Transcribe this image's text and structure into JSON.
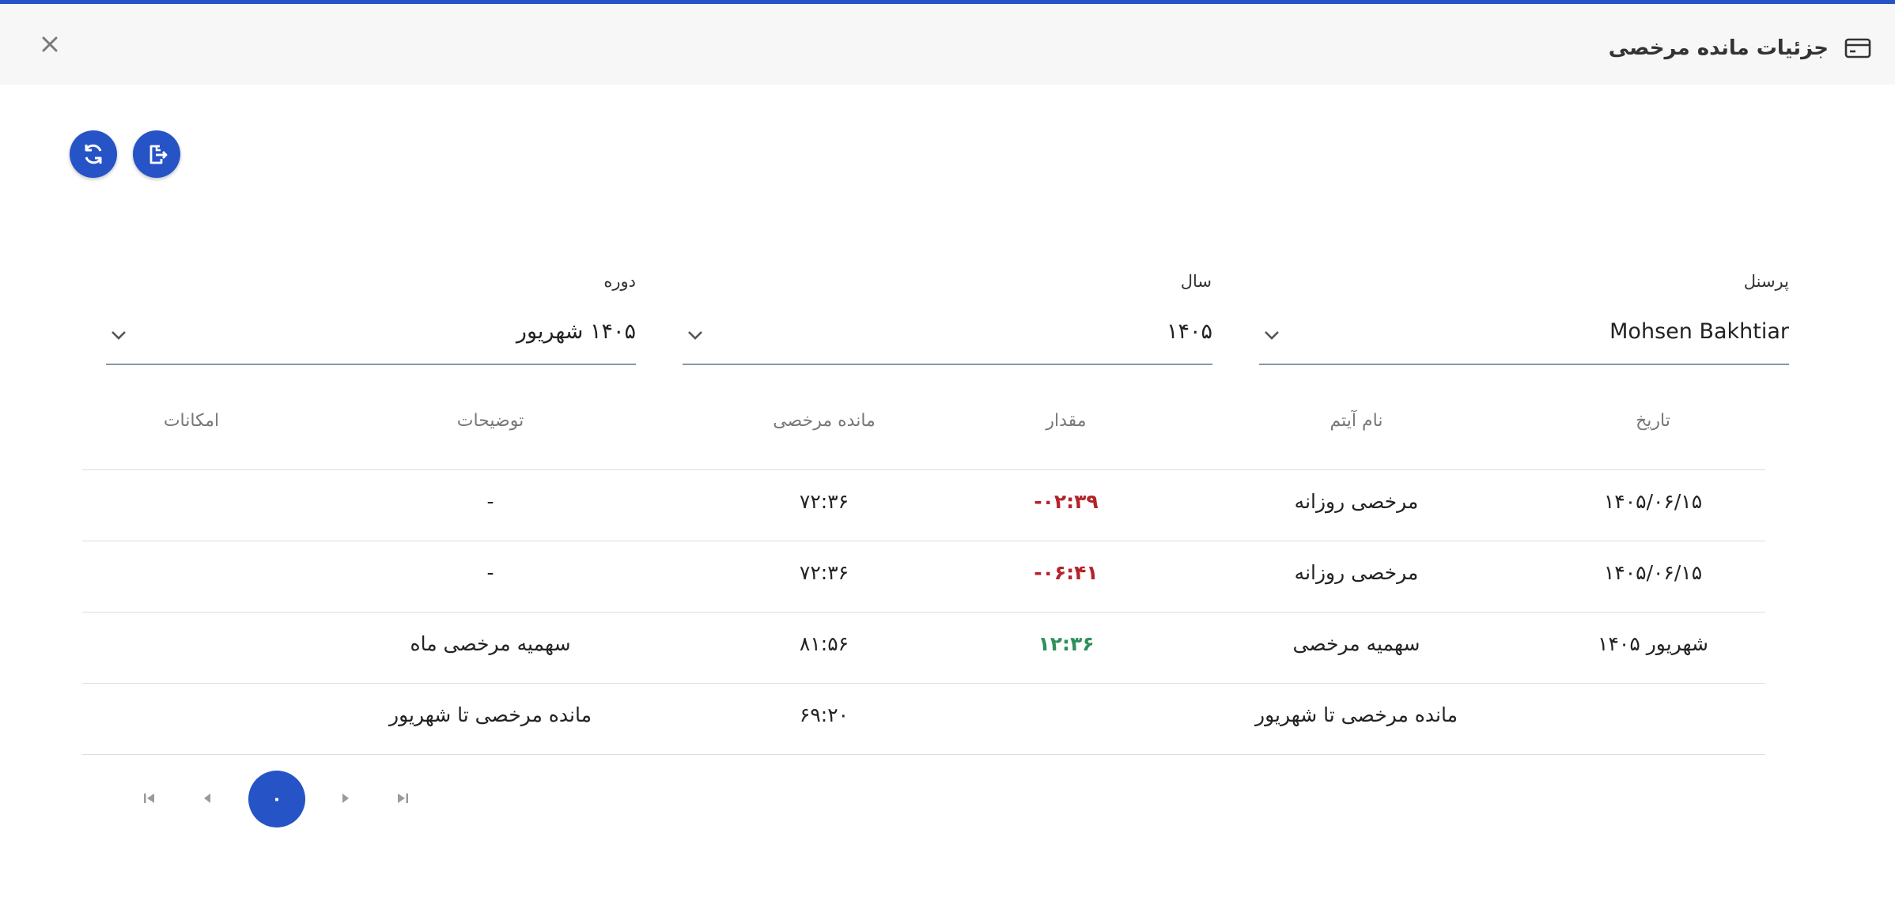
{
  "dialog": {
    "title": "جزئیات مانده مرخصی",
    "title_icon": "card-icon",
    "close_icon": "close-icon"
  },
  "toolbar": {
    "export_icon": "file-export-icon",
    "refresh_icon": "refresh-icon"
  },
  "filters": {
    "personnel": {
      "label": "پرسنل",
      "value": "Mohsen Bakhtiar"
    },
    "year": {
      "label": "سال",
      "value": "۱۴۰۵"
    },
    "period": {
      "label": "دوره",
      "value": "۱۴۰۵ شهریور"
    }
  },
  "table": {
    "headers": {
      "date": "تاریخ",
      "item": "نام آیتم",
      "amount": "مقدار",
      "remaining": "مانده مرخصی",
      "description": "توضیحات",
      "actions": "امکانات"
    },
    "rows": [
      {
        "date": "۱۴۰۵/۰۶/۱۵",
        "item": "مرخصی روزانه",
        "amount": "-۰۲:۳۹",
        "remaining": "۷۲:۳۶",
        "description": "-"
      },
      {
        "date": "۱۴۰۵/۰۶/۱۵",
        "item": "مرخصی روزانه",
        "amount": "-۰۶:۴۱",
        "remaining": "۷۲:۳۶",
        "description": "-"
      },
      {
        "date": "شهریور ۱۴۰۵",
        "item": "سهمیه مرخصی",
        "amount": "۱۲:۳۶",
        "remaining": "۸۱:۵۶",
        "description": "سهمیه مرخصی ماه"
      },
      {
        "date": "",
        "item": "مانده مرخصی تا شهریور",
        "amount": "",
        "remaining": "۶۹:۲۰",
        "description": "مانده مرخصی تا شهریور"
      }
    ]
  },
  "pagination": {
    "current_page": "۰",
    "first_icon": "first-page-icon",
    "prev_icon": "prev-page-icon",
    "next_icon": "next-page-icon",
    "last_icon": "last-page-icon"
  },
  "colors": {
    "primary": "#2653c6",
    "negative": "#b3242a",
    "positive": "#2f8f5a"
  }
}
